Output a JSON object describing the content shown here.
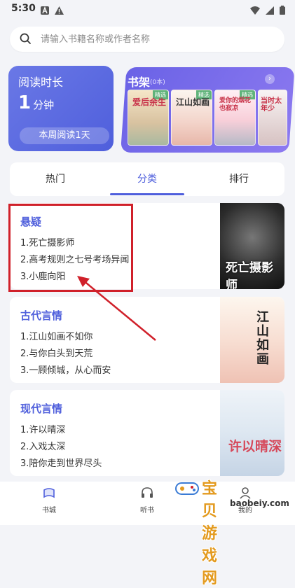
{
  "status": {
    "time": "5:30"
  },
  "search": {
    "placeholder": "请输入书籍名称或作者名称"
  },
  "reading": {
    "title": "阅读时长",
    "value": "1",
    "unit": "分钟",
    "week": "本周阅读1天"
  },
  "bookshelf": {
    "title": "书架",
    "count": "(0本)",
    "books": [
      {
        "cover_text": "爱后余生",
        "tag": "精选"
      },
      {
        "cover_text": "江山如画",
        "tag": "精选"
      },
      {
        "cover_text": "爱你的烟花也寂凉",
        "tag": "精选"
      },
      {
        "cover_text": "当时太年少",
        "tag": ""
      }
    ]
  },
  "tabs": [
    {
      "label": "热门"
    },
    {
      "label": "分类",
      "active": true
    },
    {
      "label": "排行"
    }
  ],
  "categories": [
    {
      "title": "悬疑",
      "items": [
        "1.死亡摄影师",
        "2.高考规则之七号考场异闻",
        "3.小鹿向阳"
      ],
      "cover_title": "死亡摄影师"
    },
    {
      "title": "古代言情",
      "items": [
        "1.江山如画不如你",
        "2.与你白头到天荒",
        "3.一顾倾城，从心而安"
      ],
      "cover_title": "江山如画"
    },
    {
      "title": "现代言情",
      "items": [
        "1.许以晴深",
        "2.入戏太深",
        "3.陪你走到世界尽头"
      ],
      "cover_title": "许以晴深"
    }
  ],
  "nav": [
    {
      "label": "书城",
      "icon": "book-city-icon"
    },
    {
      "label": "听书",
      "icon": "headphones-icon"
    },
    {
      "label": "我的",
      "icon": "profile-icon"
    }
  ],
  "watermark": {
    "text": "宝贝游戏网",
    "url": "baobeiy.com"
  },
  "colors": {
    "accent": "#4f5fdc",
    "highlight": "#d0202a"
  }
}
